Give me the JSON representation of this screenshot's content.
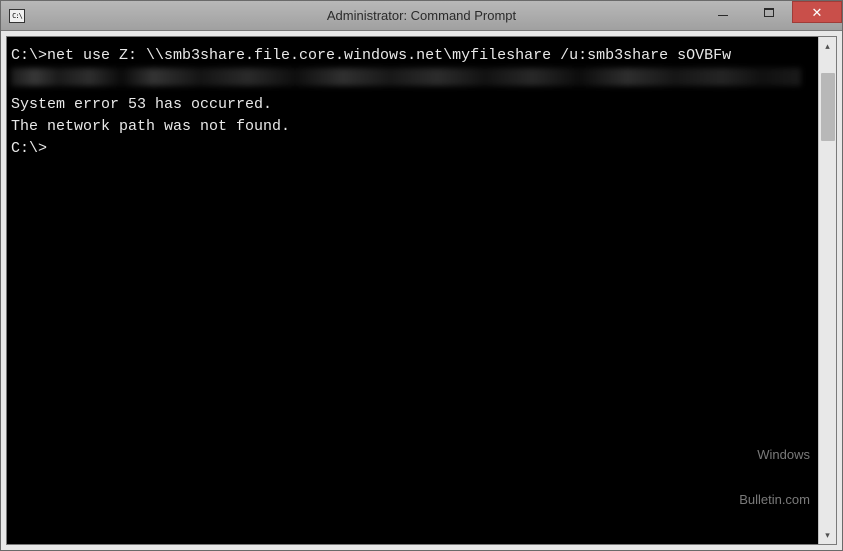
{
  "window": {
    "title": "Administrator: Command Prompt",
    "icon_label": "C:\\"
  },
  "terminal": {
    "lines": {
      "l0": "",
      "cmd": "C:\\>net use Z: \\\\smb3share.file.core.windows.net\\myfileshare /u:smb3share sOVBFw",
      "blank1": "",
      "err1": "System error 53 has occurred.",
      "blank2": "",
      "err2": "The network path was not found.",
      "blank3": "",
      "blank4": "",
      "prompt": "C:\\>"
    }
  },
  "watermark": {
    "line1": "Windows",
    "line2": "Bulletin.com"
  }
}
